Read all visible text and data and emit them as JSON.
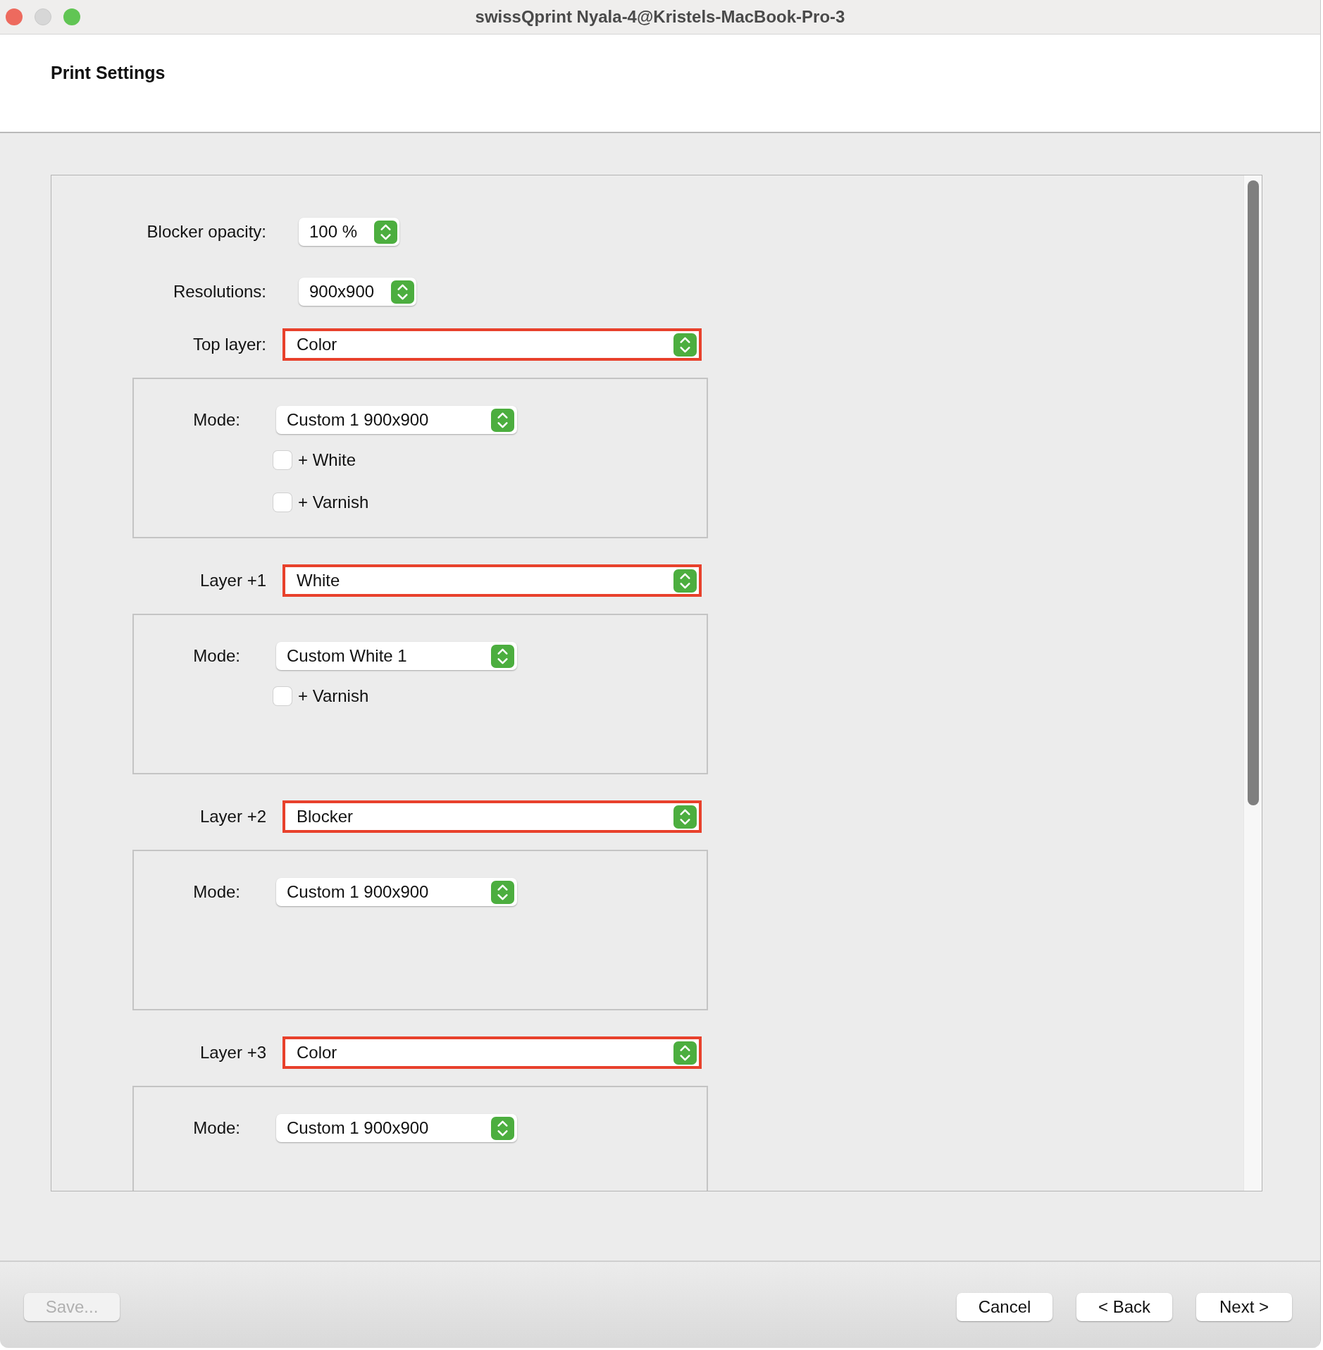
{
  "window": {
    "title": "swissQprint Nyala-4@Kristels-MacBook-Pro-3"
  },
  "header": {
    "title": "Print Settings"
  },
  "settings": [
    {
      "label": "Blocker opacity:",
      "value": "100 %"
    },
    {
      "label": "Resolutions:",
      "value": "900x900"
    }
  ],
  "layers": [
    {
      "label": "Top layer:",
      "value": "Color",
      "highlighted": true,
      "mode_label": "Mode:",
      "mode": "Custom 1 900x900",
      "options": [
        {
          "label": "+ White",
          "checked": false
        },
        {
          "label": "+ Varnish",
          "checked": false
        }
      ]
    },
    {
      "label": "Layer +1",
      "value": "White",
      "highlighted": true,
      "mode_label": "Mode:",
      "mode": "Custom White 1",
      "options": [
        {
          "label": "+ Varnish",
          "checked": false
        }
      ]
    },
    {
      "label": "Layer +2",
      "value": "Blocker",
      "highlighted": true,
      "mode_label": "Mode:",
      "mode": "Custom 1 900x900"
    },
    {
      "label": "Layer +3",
      "value": "Color",
      "highlighted": true,
      "mode_label": "Mode:",
      "mode": "Custom 1 900x900"
    }
  ],
  "buttons": [
    {
      "label": "Save...",
      "disabled": true
    },
    {
      "label": "Cancel",
      "disabled": false
    },
    {
      "label": "< Back",
      "disabled": false
    },
    {
      "label": "Next >",
      "disabled": false
    }
  ]
}
